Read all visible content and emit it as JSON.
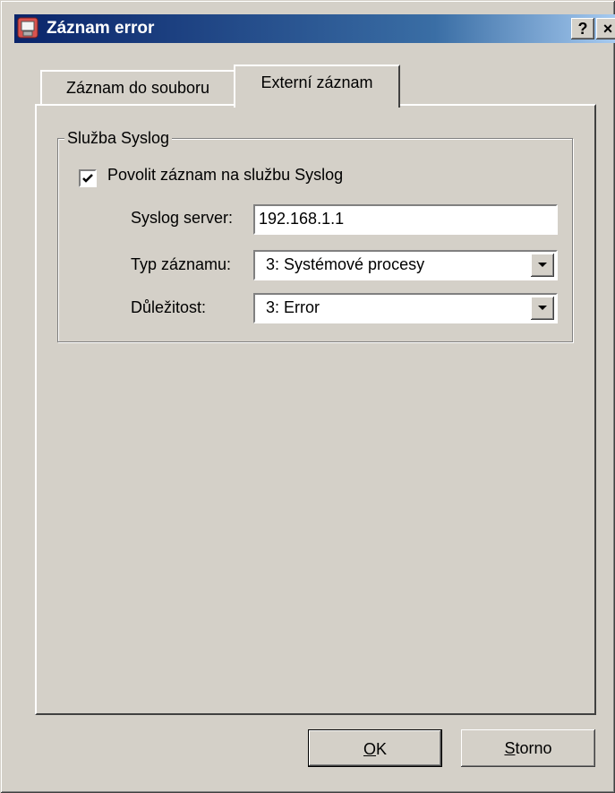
{
  "window": {
    "title": "Záznam error",
    "help_label": "?",
    "close_label": "×"
  },
  "tabs": [
    {
      "label": "Záznam do souboru",
      "active": false
    },
    {
      "label": "Externí záznam",
      "active": true
    }
  ],
  "syslog": {
    "group_title": "Služba Syslog",
    "enable_label": "Povolit záznam na službu Syslog",
    "enable_checked": true,
    "server_label": "Syslog server:",
    "server_value": "192.168.1.1",
    "type_label": "Typ záznamu:",
    "type_value": "3: Systémové procesy",
    "severity_label": "Důležitost:",
    "severity_value": "3: Error"
  },
  "buttons": {
    "ok_mnemonic": "O",
    "ok_rest": "K",
    "cancel_mnemonic": "S",
    "cancel_rest": "torno"
  }
}
